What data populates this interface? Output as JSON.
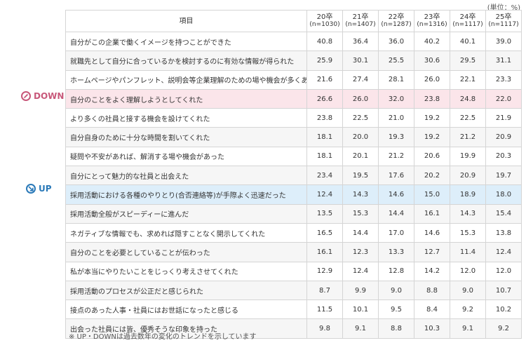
{
  "unit": "(単位：%)",
  "header": {
    "item": "項目",
    "years": [
      {
        "label": "20卒",
        "n": "(n=1030)"
      },
      {
        "label": "21卒",
        "n": "(n=1407)"
      },
      {
        "label": "22卒",
        "n": "(n=1287)"
      },
      {
        "label": "23卒",
        "n": "(n=1316)"
      },
      {
        "label": "24卒",
        "n": "(n=1117)"
      },
      {
        "label": "25卒",
        "n": "(n=1117)"
      }
    ]
  },
  "rows": [
    {
      "item": "自分がこの企業で働くイメージを持つことができた",
      "values": [
        "40.8",
        "36.4",
        "36.0",
        "40.2",
        "40.1",
        "39.0"
      ]
    },
    {
      "item": "就職先として自分に合っているかを検討するのに有効な情報が得られた",
      "values": [
        "25.9",
        "30.1",
        "25.5",
        "30.6",
        "29.5",
        "31.1"
      ]
    },
    {
      "item": "ホームページやパンフレット、説明会等企業理解のための場や機会が多くあった",
      "values": [
        "21.6",
        "27.4",
        "28.1",
        "26.0",
        "22.1",
        "23.3"
      ]
    },
    {
      "item": "自分のことをよく理解しようとしてくれた",
      "values": [
        "26.6",
        "26.0",
        "32.0",
        "23.8",
        "24.8",
        "22.0"
      ],
      "flag": "down"
    },
    {
      "item": "より多くの社員と接する機会を設けてくれた",
      "values": [
        "23.8",
        "22.5",
        "21.0",
        "19.2",
        "22.5",
        "21.9"
      ]
    },
    {
      "item": "自分自身のために十分な時間を割いてくれた",
      "values": [
        "18.1",
        "20.0",
        "19.3",
        "19.2",
        "21.2",
        "20.9"
      ]
    },
    {
      "item": "疑問や不安があれば、解消する場や機会があった",
      "values": [
        "18.1",
        "20.1",
        "21.2",
        "20.6",
        "19.9",
        "20.3"
      ]
    },
    {
      "item": "自分にとって魅力的な社員と出会えた",
      "values": [
        "23.4",
        "19.5",
        "17.6",
        "20.2",
        "20.9",
        "19.7"
      ]
    },
    {
      "item": "採用活動における各種のやりとり(合否連絡等)が手際よく迅速だった",
      "values": [
        "12.4",
        "14.3",
        "14.6",
        "15.0",
        "18.9",
        "18.0"
      ],
      "flag": "up"
    },
    {
      "item": "採用活動全般がスピーディーに進んだ",
      "values": [
        "13.5",
        "15.3",
        "14.4",
        "16.1",
        "14.3",
        "15.4"
      ]
    },
    {
      "item": "ネガティブな情報でも、求めれば隠すことなく開示してくれた",
      "values": [
        "16.5",
        "14.4",
        "17.0",
        "14.6",
        "15.3",
        "13.8"
      ]
    },
    {
      "item": "自分のことを必要としていることが伝わった",
      "values": [
        "16.1",
        "12.3",
        "13.3",
        "12.7",
        "11.4",
        "12.4"
      ]
    },
    {
      "item": "私が本当にやりたいことをじっくり考えさせてくれた",
      "values": [
        "12.9",
        "12.4",
        "12.8",
        "14.2",
        "12.0",
        "12.0"
      ]
    },
    {
      "item": "採用活動のプロセスが公正だと感じられた",
      "values": [
        "8.7",
        "9.9",
        "9.0",
        "8.8",
        "9.0",
        "10.7"
      ]
    },
    {
      "item": "接点のあった人事・社員にはお世話になったと感じる",
      "values": [
        "11.5",
        "10.1",
        "9.5",
        "8.4",
        "9.2",
        "10.2"
      ]
    },
    {
      "item": "出会った社員には皆、優秀そうな印象を持った",
      "values": [
        "9.8",
        "9.1",
        "8.8",
        "10.3",
        "9.1",
        "9.2"
      ]
    }
  ],
  "markers": {
    "down": "DOWN",
    "up": "UP",
    "down_icon": "pencil-icon",
    "up_icon": "arrow-down-right-icon"
  },
  "note": "※ UP・DOWNは過去数年の変化のトレンドを示しています",
  "colors": {
    "down_bg": "#fbe5ea",
    "up_bg": "#ddeefa",
    "down_text": "#c8587a",
    "up_text": "#2a79b8"
  }
}
